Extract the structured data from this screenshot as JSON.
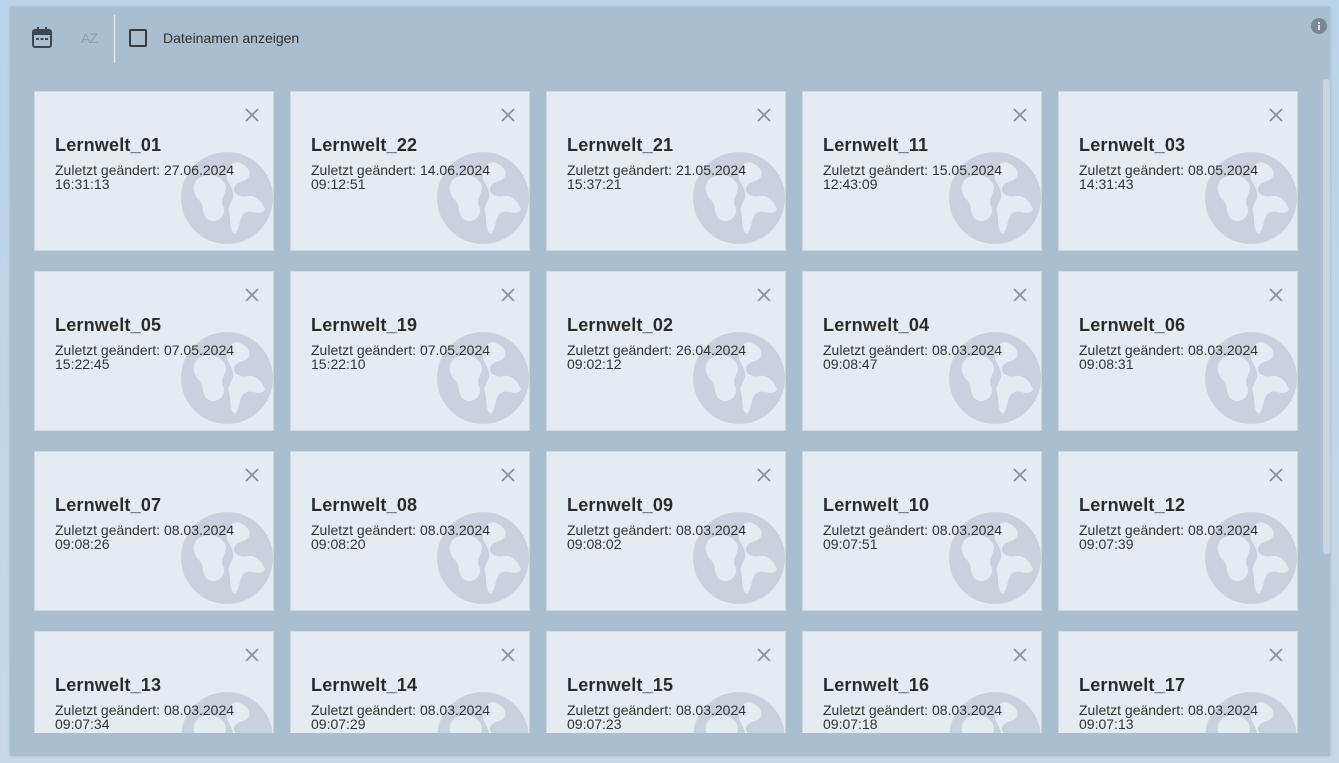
{
  "toolbar": {
    "calendar_icon": "calendar-icon",
    "sort_icon": "sort-alpha-icon",
    "sort_label": "AZ",
    "show_filenames_label": "Dateinamen anzeigen",
    "show_filenames_checked": false,
    "info_icon": "info-icon"
  },
  "cards": [
    {
      "title": "Lernwelt_01",
      "modified": "Zuletzt geändert: 27.06.2024",
      "time": "16:31:13"
    },
    {
      "title": "Lernwelt_22",
      "modified": "Zuletzt geändert: 14.06.2024",
      "time": "09:12:51"
    },
    {
      "title": "Lernwelt_21",
      "modified": "Zuletzt geändert: 21.05.2024",
      "time": "15:37:21"
    },
    {
      "title": "Lernwelt_11",
      "modified": "Zuletzt geändert: 15.05.2024",
      "time": "12:43:09"
    },
    {
      "title": "Lernwelt_03",
      "modified": "Zuletzt geändert: 08.05.2024",
      "time": "14:31:43"
    },
    {
      "title": "Lernwelt_05",
      "modified": "Zuletzt geändert: 07.05.2024",
      "time": "15:22:45"
    },
    {
      "title": "Lernwelt_19",
      "modified": "Zuletzt geändert: 07.05.2024",
      "time": "15:22:10"
    },
    {
      "title": "Lernwelt_02",
      "modified": "Zuletzt geändert: 26.04.2024",
      "time": "09:02:12"
    },
    {
      "title": "Lernwelt_04",
      "modified": "Zuletzt geändert: 08.03.2024",
      "time": "09:08:47"
    },
    {
      "title": "Lernwelt_06",
      "modified": "Zuletzt geändert: 08.03.2024",
      "time": "09:08:31"
    },
    {
      "title": "Lernwelt_07",
      "modified": "Zuletzt geändert: 08.03.2024",
      "time": "09:08:26"
    },
    {
      "title": "Lernwelt_08",
      "modified": "Zuletzt geändert: 08.03.2024",
      "time": "09:08:20"
    },
    {
      "title": "Lernwelt_09",
      "modified": "Zuletzt geändert: 08.03.2024",
      "time": "09:08:02"
    },
    {
      "title": "Lernwelt_10",
      "modified": "Zuletzt geändert: 08.03.2024",
      "time": "09:07:51"
    },
    {
      "title": "Lernwelt_12",
      "modified": "Zuletzt geändert: 08.03.2024",
      "time": "09:07:39"
    },
    {
      "title": "Lernwelt_13",
      "modified": "Zuletzt geändert: 08.03.2024",
      "time": "09:07:34"
    },
    {
      "title": "Lernwelt_14",
      "modified": "Zuletzt geändert: 08.03.2024",
      "time": "09:07:29"
    },
    {
      "title": "Lernwelt_15",
      "modified": "Zuletzt geändert: 08.03.2024",
      "time": "09:07:23"
    },
    {
      "title": "Lernwelt_16",
      "modified": "Zuletzt geändert: 08.03.2024",
      "time": "09:07:18"
    },
    {
      "title": "Lernwelt_17",
      "modified": "Zuletzt geändert: 08.03.2024",
      "time": "09:07:13"
    }
  ],
  "colors": {
    "card_bg": "#e4ebf2",
    "panel_bg": "#a9bfd0",
    "globe": "#c9d2dc"
  }
}
